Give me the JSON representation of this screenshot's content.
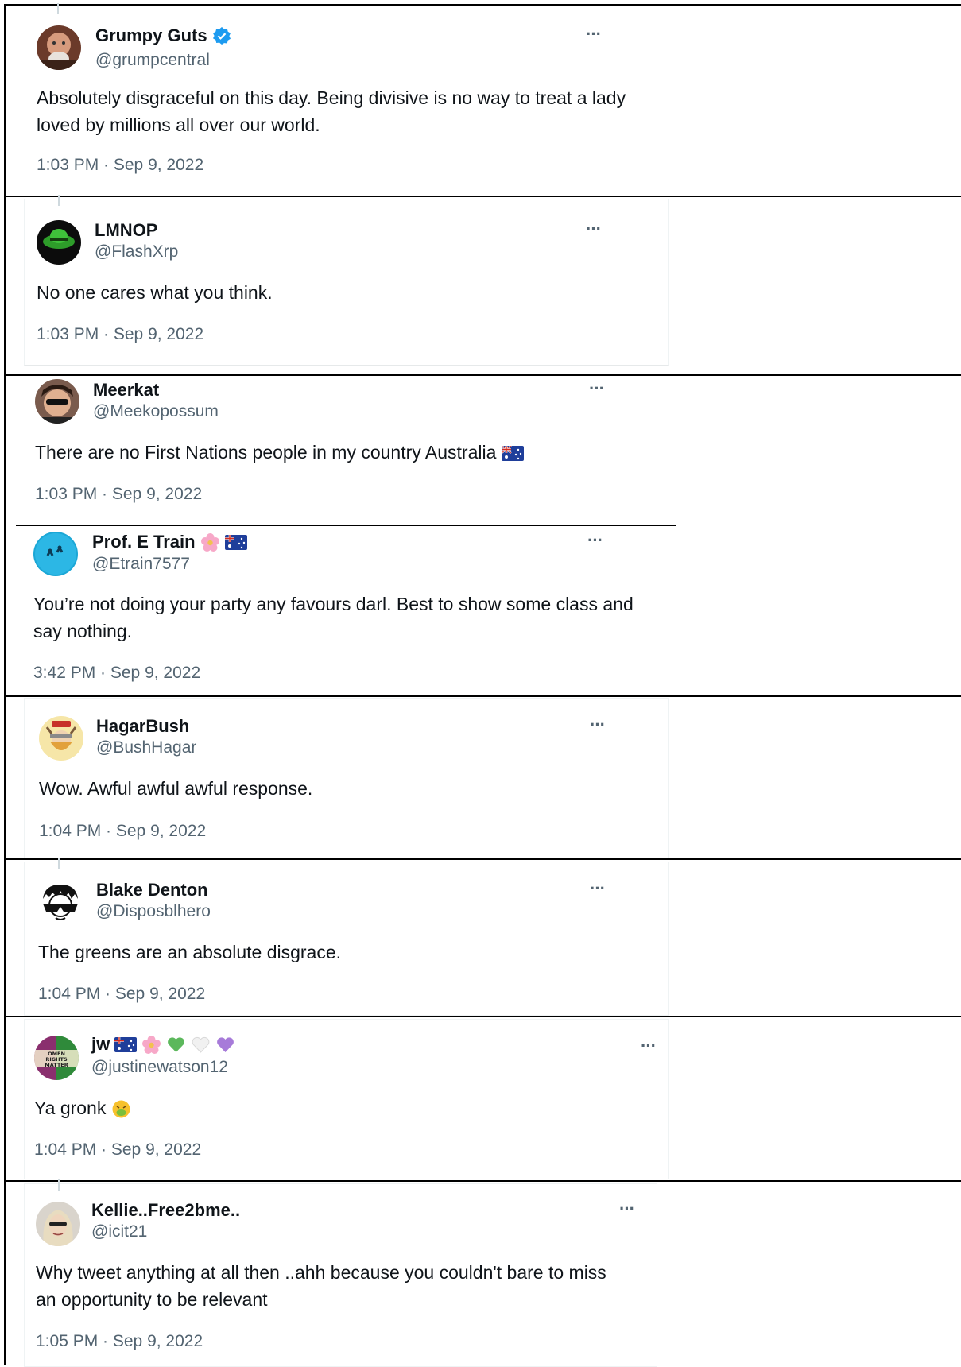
{
  "tweets": [
    {
      "name": "Grumpy Guts",
      "handle": "@grumpcentral",
      "text": "Absolutely disgraceful on this day. Being divisive is no way to treat a lady loved by millions all over our world.",
      "time": "1:03 PM · Sep 9, 2022",
      "verified": true,
      "avatar_icon": "profile-photo-man"
    },
    {
      "name": "LMNOP",
      "handle": "@FlashXrp",
      "text": "No one cares what you think.",
      "time": "1:03 PM · Sep 9, 2022",
      "avatar_icon": "green-hat-profile"
    },
    {
      "name": "Meerkat",
      "handle": "@Meekopossum",
      "text": "There are no First Nations people in my country Australia",
      "time": "1:03 PM · Sep 9, 2022",
      "emoji_after_text": "australia-flag",
      "avatar_icon": "sunglasses-profile"
    },
    {
      "name": "Prof. E Train",
      "handle": "@Etrain7577",
      "text": "You’re not doing your party any favours darl. Best to show some class and say nothing.",
      "time": "3:42 PM · Sep 9, 2022",
      "name_emojis": [
        "pink-flower",
        "australia-flag"
      ],
      "avatar_icon": "blue-swimmers-profile"
    },
    {
      "name": "HagarBush",
      "handle": "@BushHagar",
      "text": "Wow. Awful awful awful response.",
      "time": "1:04 PM · Sep 9, 2022",
      "avatar_icon": "cartoon-viking-profile"
    },
    {
      "name": "Blake Denton",
      "handle": "@Disposblhero",
      "text": "The greens are an absolute disgrace.",
      "time": "1:04 PM · Sep 9, 2022",
      "avatar_icon": "cartoon-sunglasses-profile"
    },
    {
      "name": "jw",
      "handle": "@justinewatson12",
      "text": "Ya gronk",
      "time": "1:04 PM · Sep 9, 2022",
      "name_emojis": [
        "australia-flag",
        "pink-flower",
        "green-heart",
        "white-heart",
        "purple-heart"
      ],
      "emoji_after_text": "vomiting-face",
      "avatar_text": "OMEN RIGHTS MATTER",
      "avatar_icon": "womens-rights-profile"
    },
    {
      "name": "Kellie..Free2bme..",
      "handle": "@icit21",
      "text": "Why tweet anything at all then ..ahh because you couldn't bare to miss an opportunity to be relevant",
      "time": "1:05 PM · Sep 9, 2022",
      "avatar_icon": "woman-sunglasses-profile"
    }
  ],
  "more_label": "···",
  "colors": {
    "verified": "#1d9bf0",
    "secondary_text": "#536471",
    "primary_text": "#0f1419"
  }
}
